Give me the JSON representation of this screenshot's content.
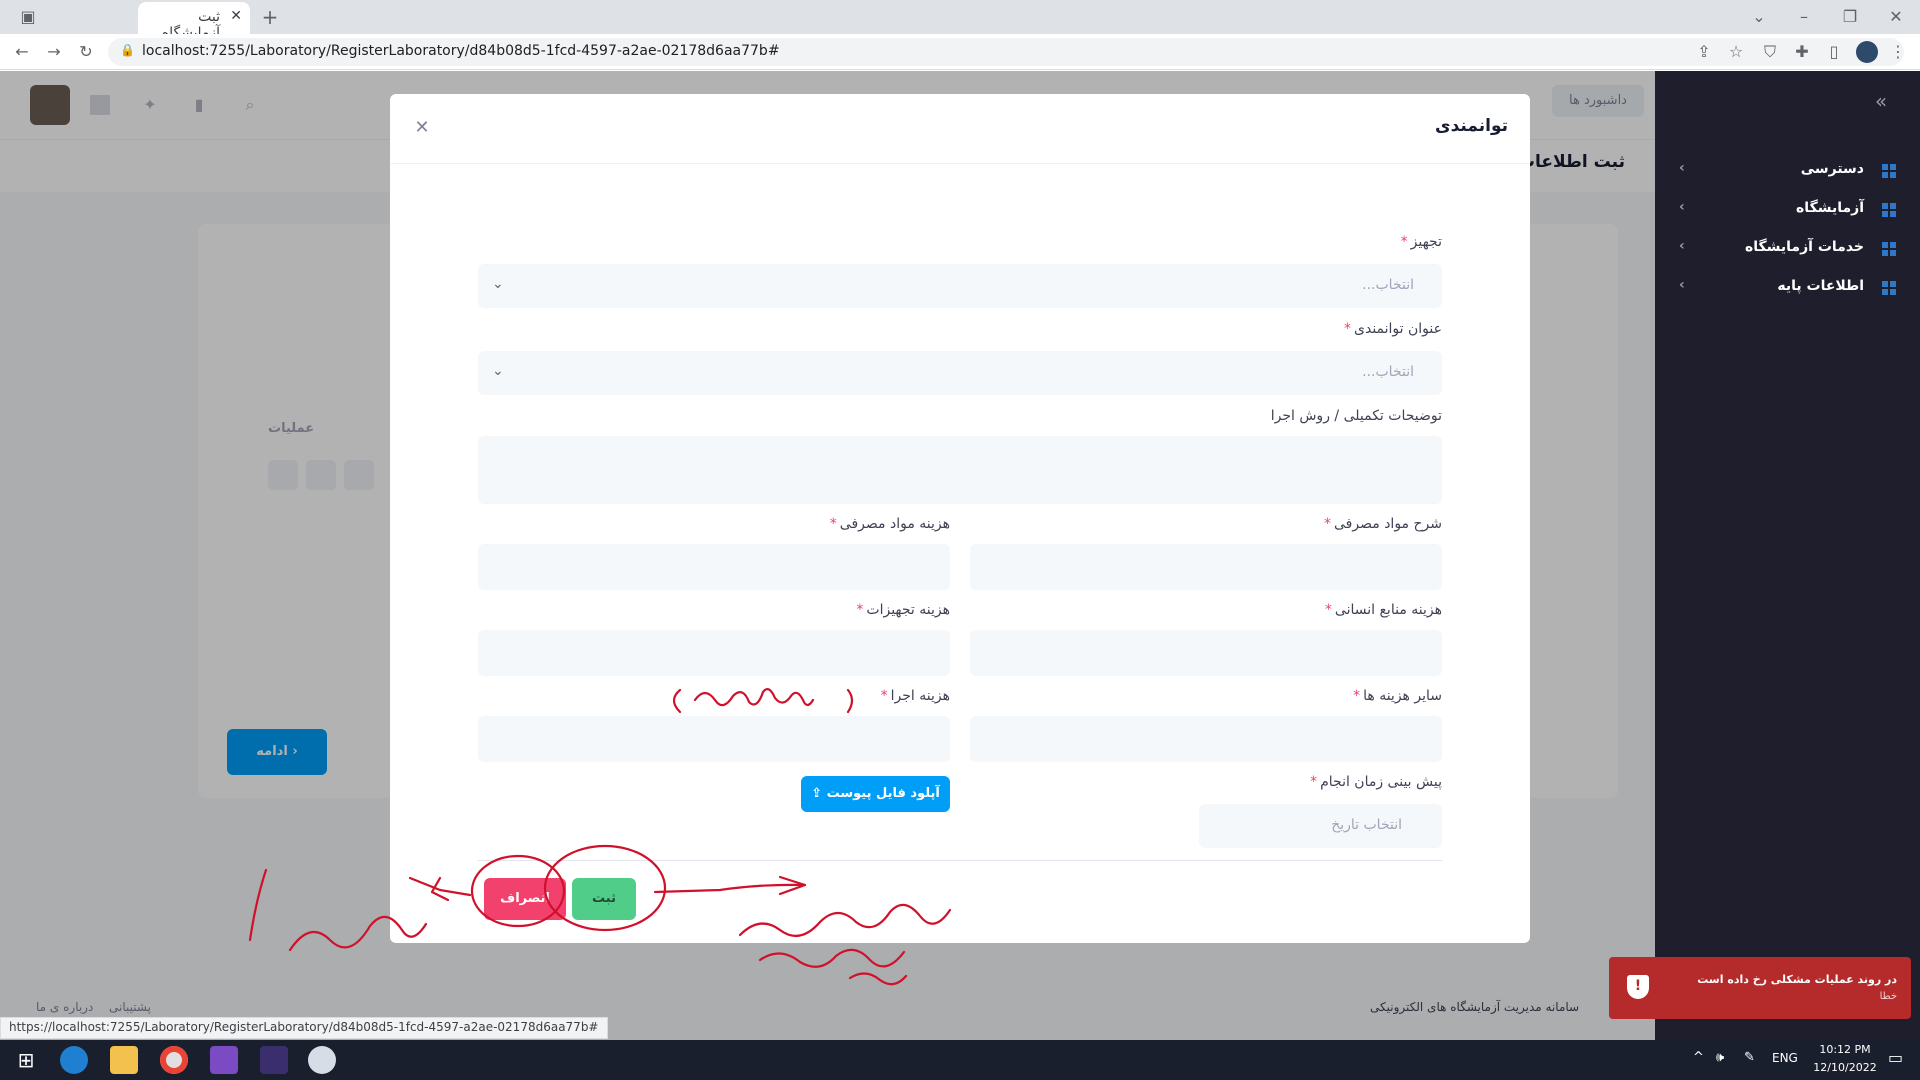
{
  "browser": {
    "tab_title": "ثبت آزمایشگاه",
    "url": "localhost:7255/Laboratory/RegisterLaboratory/d84b08d5-1fcd-4597-a2ae-02178d6aa77b#",
    "status_url": "https://localhost:7255/Laboratory/RegisterLaboratory/d84b08d5-1fcd-4597-a2ae-02178d6aa77b#"
  },
  "header": {
    "dashboard_label": "داشبورد ها",
    "page_title": "ثبت اطلاعات"
  },
  "sidebar": {
    "items": [
      {
        "label": "دسترسی"
      },
      {
        "label": "آزمایشگاه"
      },
      {
        "label": "خدمات آزمایشگاه"
      },
      {
        "label": "اطلاعات پایه"
      }
    ]
  },
  "background": {
    "operations_header": "عملیات",
    "continue_button": "ادامه"
  },
  "modal": {
    "title": "توانمندی",
    "equipment_label": "تجهیز",
    "equipment_placeholder": "انتخاب...",
    "capability_title_label": "عنوان توانمندی",
    "capability_title_placeholder": "انتخاب...",
    "description_label": "توضیحات تکمیلی / روش اجرا",
    "consumables_desc_label": "شرح مواد مصرفی",
    "consumables_cost_label": "هزینه مواد مصرفی",
    "hr_cost_label": "هزینه منابع انسانی",
    "equipment_cost_label": "هزینه تجهیزات",
    "other_cost_label": "سایر هزینه ها",
    "execution_cost_label": "هزینه اجرا",
    "estimated_time_label": "پیش بینی زمان انجام",
    "date_placeholder": "انتخاب تاریخ",
    "upload_button": "آپلود فایل پیوست",
    "submit_button": "ثبت",
    "cancel_button": "انصراف"
  },
  "footer": {
    "about": "درباره ی ما",
    "support": "پشتیبانی",
    "copyright": "سامانه مدیریت آزمایشگاه های الکترونیکی"
  },
  "toast": {
    "message": "در روند عملیات مشکلی رخ داده است",
    "type": "خطا"
  },
  "taskbar": {
    "lang": "ENG",
    "time": "10:12 PM",
    "date": "12/10/2022"
  },
  "colors": {
    "primary": "#009ef7",
    "success": "#50cd89",
    "danger": "#f1416c",
    "sidebar": "#1e1e2d",
    "toast": "#b52a2a"
  }
}
